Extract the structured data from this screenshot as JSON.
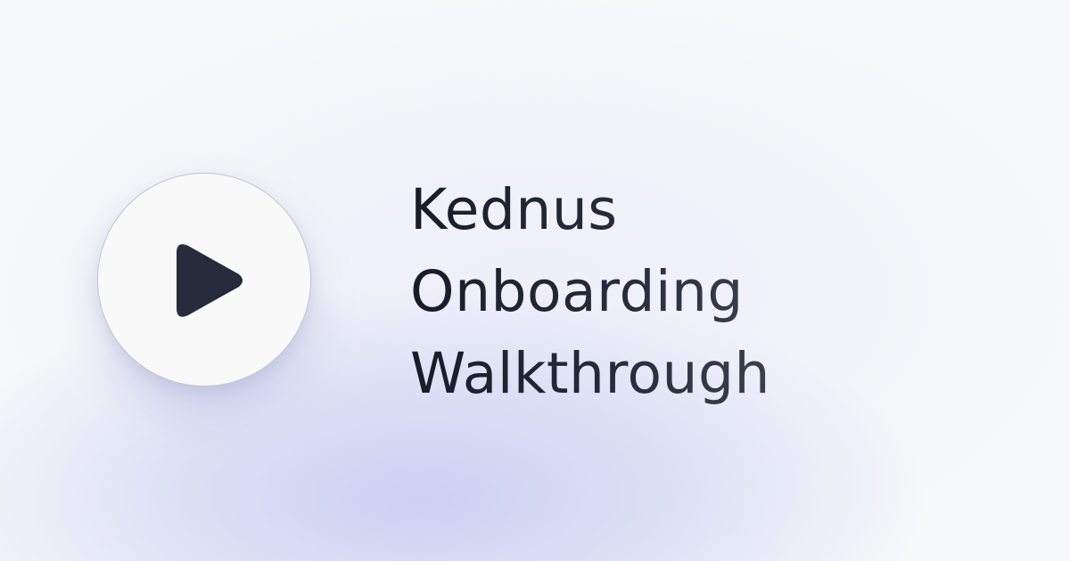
{
  "title_lines": [
    "Kednus",
    "Onboarding",
    "Walkthrough"
  ],
  "play_button": {
    "icon": "play-icon"
  },
  "colors": {
    "background": "#f7f8fa",
    "glow": "#c4caf0",
    "button_fill": "#f9f9fa",
    "icon": "#252c3b",
    "title_text": "#1b2130"
  }
}
